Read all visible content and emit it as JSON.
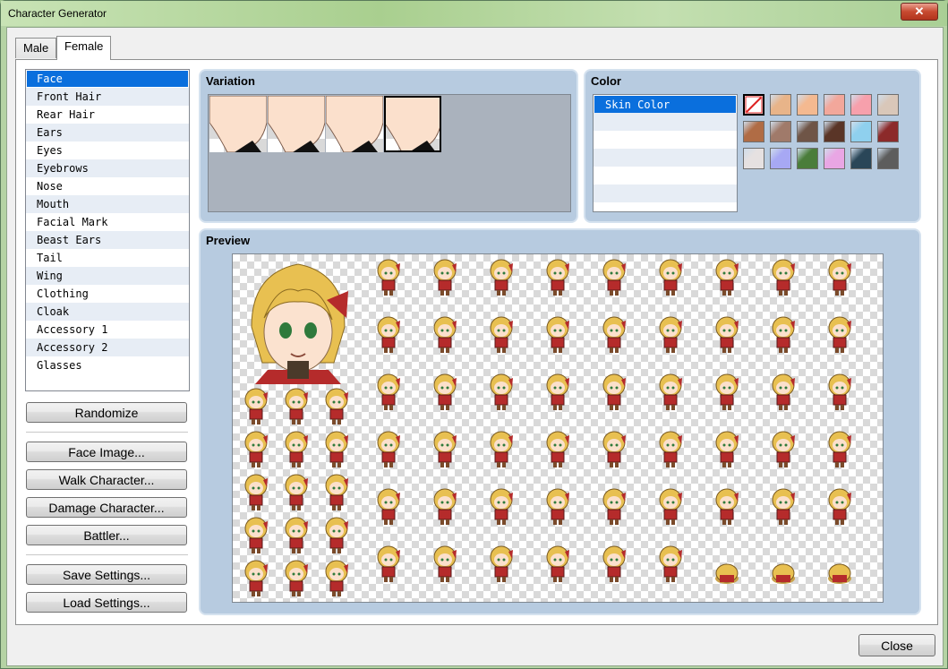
{
  "window": {
    "title": "Character Generator",
    "close_glyph": "✕"
  },
  "tabs": [
    {
      "label": "Male",
      "active": false
    },
    {
      "label": "Female",
      "active": true
    }
  ],
  "parts": [
    "Face",
    "Front Hair",
    "Rear Hair",
    "Ears",
    "Eyes",
    "Eyebrows",
    "Nose",
    "Mouth",
    "Facial Mark",
    "Beast Ears",
    "Tail",
    "Wing",
    "Clothing",
    "Cloak",
    "Accessory 1",
    "Accessory 2",
    "Glasses"
  ],
  "selected_part": "Face",
  "buttons": {
    "randomize": "Randomize",
    "face_image": "Face Image...",
    "walk_character": "Walk Character...",
    "damage_character": "Damage Character...",
    "battler": "Battler...",
    "save_settings": "Save Settings...",
    "load_settings": "Load Settings...",
    "close": "Close"
  },
  "variation": {
    "label": "Variation",
    "count": 4,
    "selected_index": 3
  },
  "color": {
    "label": "Color",
    "items": [
      "Skin Color"
    ],
    "palette": [
      "none",
      "#e8b489",
      "#f4b990",
      "#f2a79b",
      "#f7a0ac",
      "#d9c7b9",
      "#b06c45",
      "#a07a6a",
      "#6f5547",
      "#5a3527",
      "#8fd0ee",
      "#8c2a2a",
      "#e6e1e1",
      "#a7a8f4",
      "#4a7d3a",
      "#e9a6e4",
      "#2a4658",
      "#5d5d5d"
    ],
    "selected_index": 0
  },
  "preview": {
    "label": "Preview"
  },
  "colors": {
    "selection": "#0a6fdd",
    "group_bg": "#b7cbe0",
    "hair": "#e8c051",
    "outfit": "#b52b2b"
  }
}
